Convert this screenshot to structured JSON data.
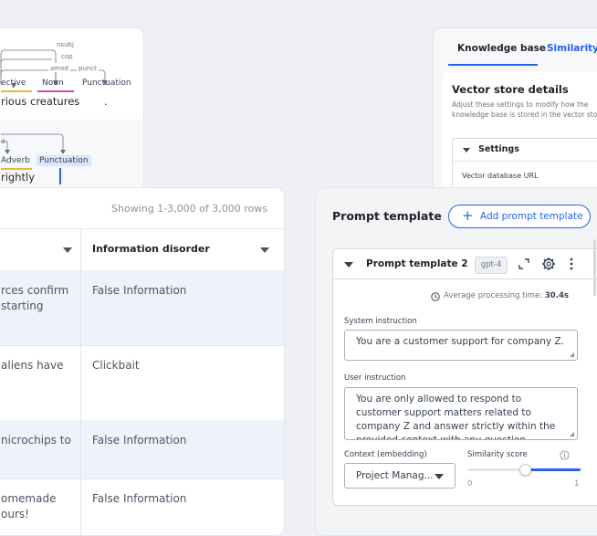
{
  "dependency_view": {
    "arc_labels": [
      "nsubj",
      "cop",
      "amod",
      "punct"
    ],
    "pos_tags": [
      "ective",
      "Noun",
      "Punctuation"
    ],
    "words": [
      "rious",
      "creatures",
      "."
    ],
    "lower_arc_label": "d",
    "lower_pos_tags": [
      "Adverb",
      "Punctuation"
    ],
    "lower_words": [
      "rightly"
    ],
    "colors": {
      "adjective": "#e3b93a",
      "noun": "#d14aa8",
      "punctuation": "#9aa0a6"
    }
  },
  "table": {
    "rows_count": "Showing 1-3,000 of 3,000 rows",
    "column_header": "Information disorder",
    "rows": [
      {
        "text": "rces confirm\nstarting",
        "label": "False Information"
      },
      {
        "text": "aliens have",
        "label": "Clickbait"
      },
      {
        "text": "nicrochips to",
        "label": "False Information"
      },
      {
        "text": "omemade\nours!",
        "label": "False Information"
      }
    ]
  },
  "vector_store": {
    "tabs": [
      "Knowledge base",
      "Similarity se"
    ],
    "title": "Vector store details",
    "description": "Adjust these settings to modify how the knowledge base is stored in the vector store.",
    "settings_label": "Settings",
    "db_url_label": "Vector database URL"
  },
  "prompt_template": {
    "title": "Prompt template",
    "add_button": "Add prompt template",
    "template_name": "Prompt template 2",
    "model": "gpt-4",
    "processing_label": "Average processing time:",
    "processing_value": "30.4s",
    "system_label": "System instruction",
    "system_value": "You are a customer support for company Z.",
    "user_label": "User instruction",
    "user_value": "You are only allowed to respond to customer support matters related to company Z and answer strictly within the provided context with any question",
    "context_label": "Context (embedding)",
    "context_value": "Project Manag...",
    "similarity_label": "Similarity score",
    "similarity_min": "0",
    "similarity_max": "1",
    "similarity_level": 0.5,
    "accent_color": "#2563eb"
  }
}
